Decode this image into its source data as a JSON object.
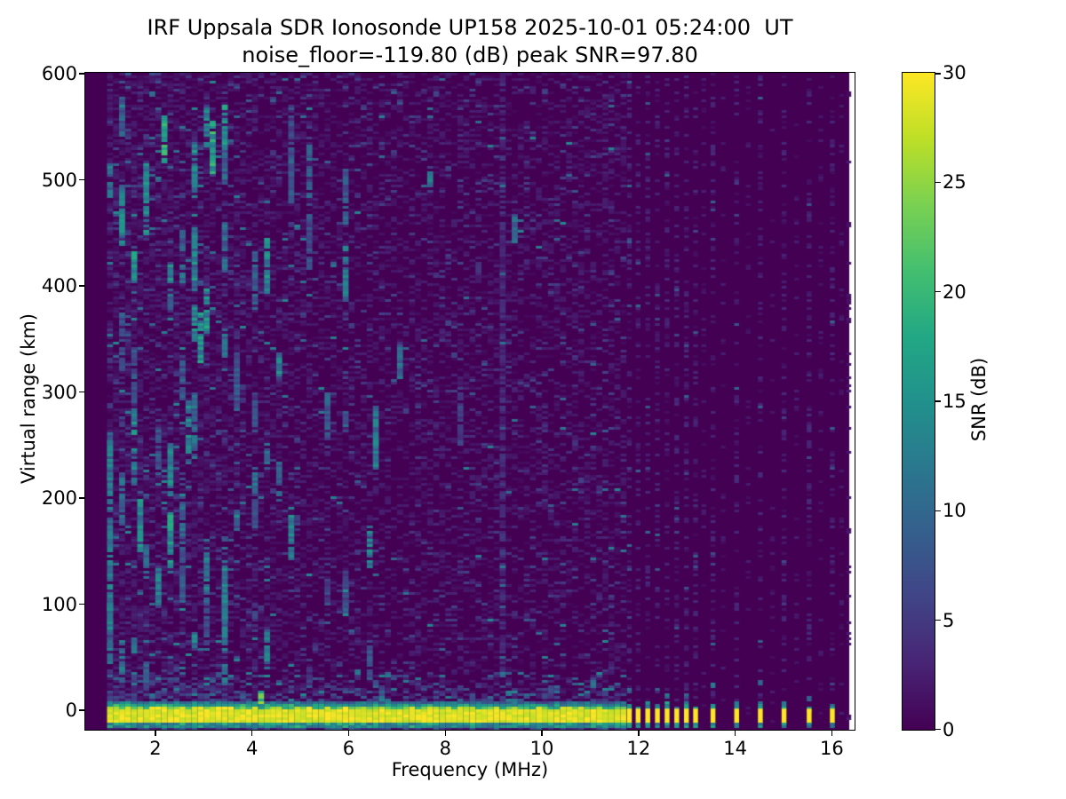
{
  "figure": {
    "title_line1": "IRF Uppsala SDR Ionosonde UP158 2025-10-01 05:24:00  UT",
    "title_line2": "noise_floor=-119.80 (dB) peak SNR=97.80"
  },
  "chart_data": {
    "type": "heatmap",
    "title": "IRF Uppsala SDR Ionosonde UP158 2025-10-01 05:24:00 UT",
    "subtitle": "noise_floor=-119.80 (dB) peak SNR=97.80",
    "station": "UP158",
    "timestamp_ut": "2025-10-01 05:24:00",
    "noise_floor_db": -119.8,
    "peak_snr_db": 97.8,
    "xlabel": "Frequency (MHz)",
    "ylabel": "Virtual range (km)",
    "xlim": [
      0.55,
      16.47
    ],
    "ylim": [
      -18.4,
      600.9
    ],
    "x_ticks": [
      2,
      4,
      6,
      8,
      10,
      12,
      14,
      16
    ],
    "y_ticks": [
      0,
      100,
      200,
      300,
      400,
      500,
      600
    ],
    "grid": false,
    "legend_position": "none",
    "colorbar": {
      "label": "SNR (dB)",
      "min": 0,
      "max": 30,
      "ticks": [
        0,
        5,
        10,
        15,
        20,
        25,
        30
      ],
      "colormap": "viridis"
    },
    "colormap_stops": [
      [
        0.0,
        "#440154"
      ],
      [
        0.1,
        "#482475"
      ],
      [
        0.2,
        "#414487"
      ],
      [
        0.3,
        "#355f8d"
      ],
      [
        0.4,
        "#2a788e"
      ],
      [
        0.5,
        "#21918c"
      ],
      [
        0.6,
        "#22a884"
      ],
      [
        0.7,
        "#44bf70"
      ],
      [
        0.8,
        "#7ad151"
      ],
      [
        0.9,
        "#bddf26"
      ],
      [
        1.0,
        "#fde725"
      ]
    ],
    "data_extent": {
      "freq_mhz": [
        1.0,
        16.36
      ],
      "range_km": [
        -18.4,
        600.9
      ]
    },
    "sweep": {
      "continuous_mhz": [
        1.0,
        11.67
      ],
      "freq_step_mhz": 0.125,
      "range_step_km": 2.5
    },
    "features": {
      "ground_pulse_band": {
        "freq_mhz": [
          1.0,
          11.67
        ],
        "core_km": [
          -12.5,
          1.5
        ],
        "core_snr_db": 30,
        "fringe_km": [
          -16.5,
          8
        ],
        "fringe_snr_db": 15
      },
      "discrete_pulse_freqs_mhz": [
        11.76,
        11.94,
        12.14,
        12.34,
        12.54,
        12.74,
        12.94,
        13.13,
        13.49,
        13.98,
        14.47,
        14.96,
        15.48,
        15.96
      ],
      "faint_noise_column_freqs_mhz": [
        13.3,
        13.7,
        14.22,
        14.72,
        15.22,
        15.72,
        16.15,
        16.3
      ],
      "echo_cluster_freqs_mhz": [
        1.05,
        1.3,
        1.55,
        1.8,
        2.05,
        2.3,
        2.55,
        2.8,
        3.05,
        3.35,
        3.65,
        3.95,
        4.2,
        4.5,
        4.8,
        5.15,
        5.45,
        5.9,
        6.4,
        7.0,
        7.6,
        8.3
      ],
      "bright_echoes": [
        {
          "f": 1.03,
          "km": [
            55,
            255
          ],
          "snr": 13
        },
        {
          "f": 2.08,
          "km": [
            515,
            560
          ],
          "snr": 21
        },
        {
          "f": 3.1,
          "km": [
            508,
            556
          ],
          "snr": 19
        },
        {
          "f": 2.3,
          "km": [
            135,
            185
          ],
          "snr": 17
        },
        {
          "f": 1.6,
          "km": [
            152,
            200
          ],
          "snr": 15
        },
        {
          "f": 2.85,
          "km": [
            328,
            376
          ],
          "snr": 16
        },
        {
          "f": 4.2,
          "km": [
            393,
            445
          ],
          "snr": 15
        },
        {
          "f": 6.45,
          "km": [
            228,
            286
          ],
          "snr": 13
        },
        {
          "f": 2.6,
          "km": [
            243,
            292
          ],
          "snr": 14
        },
        {
          "f": 3.35,
          "km": [
            58,
            112
          ],
          "snr": 13
        },
        {
          "f": 9.4,
          "km": [
            440,
            470
          ],
          "snr": 11
        },
        {
          "f": 4.15,
          "km": [
            2,
            18
          ],
          "snr": 24
        }
      ],
      "rfi_lines": [
        {
          "f": 9.12,
          "km": [
            35,
            600
          ],
          "snr": 5
        }
      ]
    }
  }
}
